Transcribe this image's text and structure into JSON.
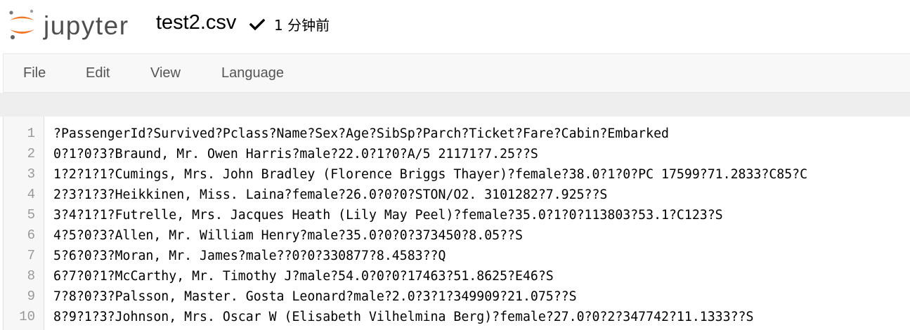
{
  "header": {
    "logo_text": "jupyter",
    "file_name": "test2.csv",
    "save_status": "1 分钟前"
  },
  "menu": {
    "items": [
      {
        "label": "File"
      },
      {
        "label": "Edit"
      },
      {
        "label": "View"
      },
      {
        "label": "Language"
      }
    ]
  },
  "editor": {
    "lines": [
      {
        "number": "1",
        "text": "?PassengerId?Survived?Pclass?Name?Sex?Age?SibSp?Parch?Ticket?Fare?Cabin?Embarked"
      },
      {
        "number": "2",
        "text": "0?1?0?3?Braund, Mr. Owen Harris?male?22.0?1?0?A/5 21171?7.25??S"
      },
      {
        "number": "3",
        "text": "1?2?1?1?Cumings, Mrs. John Bradley (Florence Briggs Thayer)?female?38.0?1?0?PC 17599?71.2833?C85?C"
      },
      {
        "number": "4",
        "text": "2?3?1?3?Heikkinen, Miss. Laina?female?26.0?0?0?STON/O2. 3101282?7.925??S"
      },
      {
        "number": "5",
        "text": "3?4?1?1?Futrelle, Mrs. Jacques Heath (Lily May Peel)?female?35.0?1?0?113803?53.1?C123?S"
      },
      {
        "number": "6",
        "text": "4?5?0?3?Allen, Mr. William Henry?male?35.0?0?0?373450?8.05??S"
      },
      {
        "number": "7",
        "text": "5?6?0?3?Moran, Mr. James?male??0?0?330877?8.4583??Q"
      },
      {
        "number": "8",
        "text": "6?7?0?1?McCarthy, Mr. Timothy J?male?54.0?0?0?17463?51.8625?E46?S"
      },
      {
        "number": "9",
        "text": "7?8?0?3?Palsson, Master. Gosta Leonard?male?2.0?3?1?349909?21.075??S"
      },
      {
        "number": "10",
        "text": "8?9?1?3?Johnson, Mrs. Oscar W (Elisabeth Vilhelmina Berg)?female?27.0?0?2?347742?11.1333??S"
      }
    ]
  }
}
